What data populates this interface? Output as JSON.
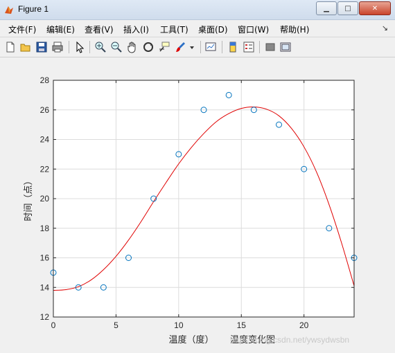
{
  "window": {
    "title": "Figure 1",
    "buttons": {
      "minimize": "▁",
      "maximize": "□",
      "close": "✕"
    }
  },
  "menu": {
    "items": [
      "文件(F)",
      "编辑(E)",
      "查看(V)",
      "插入(I)",
      "工具(T)",
      "桌面(D)",
      "窗口(W)",
      "帮助(H)"
    ],
    "overflow_glyph": "↘"
  },
  "toolbar": {
    "icons": [
      "new-figure-icon",
      "open-file-icon",
      "save-icon",
      "print-icon",
      "pointer-icon",
      "zoom-in-icon",
      "zoom-out-icon",
      "pan-hand-icon",
      "rotate-3d-icon",
      "data-cursor-icon",
      "brush-icon",
      "brush-dropdown-icon",
      "link-plot-icon",
      "colorbar-icon",
      "legend-icon",
      "hide-plot-tools-icon",
      "show-plot-tools-icon"
    ]
  },
  "watermark": "https://blog.csdn.net/ywsydwsbn",
  "chart_data": {
    "type": "scatter",
    "xlabel": "温度（度）",
    "ylabel": "时间（点）",
    "caption": "温度变化图",
    "xlim": [
      0,
      24
    ],
    "ylim": [
      12,
      28
    ],
    "xticks": [
      0,
      5,
      10,
      15,
      20
    ],
    "yticks": [
      12,
      14,
      16,
      18,
      20,
      22,
      24,
      26,
      28
    ],
    "grid": true,
    "series": [
      {
        "kind": "markers",
        "marker": "circle",
        "color": "#0072bd",
        "x": [
          0,
          2,
          4,
          6,
          8,
          10,
          12,
          14,
          16,
          18,
          20,
          22,
          24
        ],
        "y": [
          15,
          14,
          14,
          16,
          20,
          23,
          26,
          27,
          26,
          25,
          22,
          18,
          16
        ]
      },
      {
        "kind": "fit-line",
        "color": "#e00000",
        "x": [
          0,
          1,
          2,
          3,
          4,
          5,
          6,
          7,
          8,
          9,
          10,
          11,
          12,
          13,
          14,
          15,
          16,
          17,
          18,
          19,
          20,
          21,
          22,
          23,
          24
        ],
        "y": [
          13.8,
          13.85,
          14.05,
          14.5,
          15.2,
          16.1,
          17.2,
          18.45,
          19.8,
          21.1,
          22.35,
          23.45,
          24.4,
          25.2,
          25.75,
          26.1,
          26.2,
          26.05,
          25.6,
          24.75,
          23.5,
          21.8,
          19.6,
          17.0,
          14.1
        ]
      }
    ]
  }
}
